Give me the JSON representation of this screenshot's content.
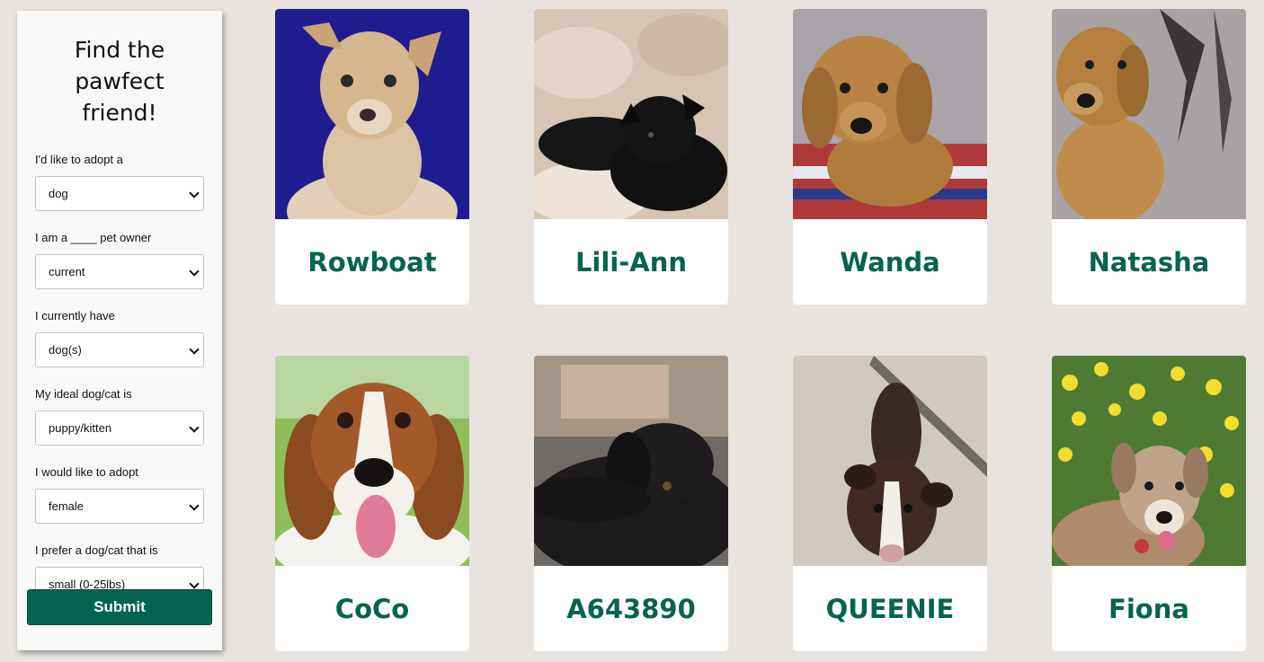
{
  "sidebar": {
    "title": "Find the pawfect friend!",
    "fields": [
      {
        "label": "I'd like to adopt a",
        "value": "dog"
      },
      {
        "label": "I am a ____ pet owner",
        "value": "current"
      },
      {
        "label": "I currently have",
        "value": "dog(s)"
      },
      {
        "label": "My ideal dog/cat is",
        "value": "puppy/kitten"
      },
      {
        "label": "I would like to adopt",
        "value": "female"
      },
      {
        "label": "I prefer a dog/cat that is",
        "value": "small (0-25lbs)"
      }
    ],
    "submit_label": "Submit"
  },
  "pets": [
    {
      "name": "Rowboat"
    },
    {
      "name": "Lili-Ann"
    },
    {
      "name": "Wanda"
    },
    {
      "name": "Natasha"
    },
    {
      "name": "CoCo"
    },
    {
      "name": "A643890"
    },
    {
      "name": "QUEENIE"
    },
    {
      "name": "Fiona"
    }
  ],
  "colors": {
    "brand_green": "#046450",
    "page_background": "#e8e3de"
  }
}
